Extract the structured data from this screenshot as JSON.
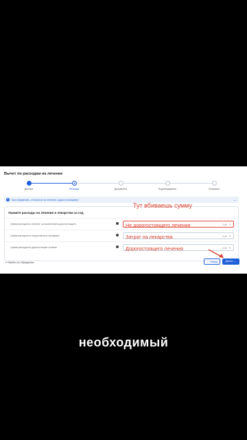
{
  "page": {
    "title": "Вычет по расходам на лечение"
  },
  "stepper": {
    "steps": [
      {
        "label": "Данные",
        "state": "done"
      },
      {
        "label": "Расходы",
        "state": "active"
      },
      {
        "label": "Документы",
        "state": "pending"
      },
      {
        "label": "Подтверждение",
        "state": "pending"
      },
      {
        "label": "Отправка",
        "state": "pending"
      }
    ]
  },
  "info": {
    "text": "Как определить, относится ли лечение к дорогостоящему?",
    "icon": "info-icon"
  },
  "form": {
    "title": "Укажите расходы на лечение и лекарства за год",
    "rows": [
      {
        "label": "Сумма расходов на лечение, за исключением дорогостоящего",
        "annotation": "Не дорогостоящего лечения",
        "value": "0,00"
      },
      {
        "label": "Сумма расходов на лекарственные препараты",
        "annotation": "Затрат на лекарства",
        "value": "0,00"
      },
      {
        "label": "Сумма расходов на дорогостоящее лечение",
        "annotation": "Дорогостоящего лечения",
        "value": "0,00"
      }
    ]
  },
  "annotation": {
    "text": "Тут вбиваешь сумму",
    "color": "#d9412f"
  },
  "footer": {
    "exit_label": "Выйти из обращения",
    "back_label": "Назад",
    "next_label": "Далее"
  },
  "caption": {
    "text": "необходимый"
  },
  "colors": {
    "accent": "#1e5fd9",
    "annotation": "#d9412f",
    "background": "#000000"
  }
}
